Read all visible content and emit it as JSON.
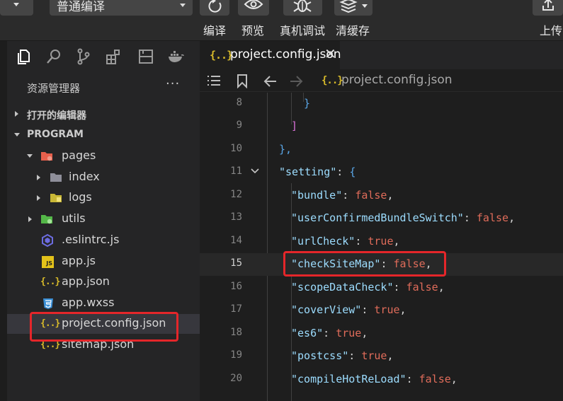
{
  "toolbar": {
    "mode_select": "普通编译",
    "compile_label": "编译",
    "preview_label": "预览",
    "device_debug_label": "真机调试",
    "clear_cache_label": "清缓存",
    "upload_label": "上传"
  },
  "sidebar": {
    "explorer_title": "资源管理器",
    "more_label": "···",
    "open_editors_label": "打开的编辑器",
    "project_label": "PROGRAM",
    "tree": [
      {
        "name": "pages",
        "kind": "folder",
        "expanded": true
      },
      {
        "name": "index",
        "kind": "folder",
        "expanded": false
      },
      {
        "name": "logs",
        "kind": "folder",
        "expanded": false
      },
      {
        "name": "utils",
        "kind": "folder",
        "expanded": false
      },
      {
        "name": ".eslintrc.js",
        "kind": "eslint"
      },
      {
        "name": "app.js",
        "kind": "js"
      },
      {
        "name": "app.json",
        "kind": "json"
      },
      {
        "name": "app.wxss",
        "kind": "css"
      },
      {
        "name": "project.config.json",
        "kind": "json",
        "selected": true
      },
      {
        "name": "sitemap.json",
        "kind": "json"
      }
    ]
  },
  "editor": {
    "tab_title": "project.config.json",
    "breadcrumb_file": "project.config.json",
    "json_icon": "{..}",
    "js_icon_text": "JS",
    "current_line": 15,
    "lines": [
      {
        "num": "8",
        "text": "}"
      },
      {
        "num": "9",
        "text": "]"
      },
      {
        "num": "10",
        "text": "},"
      },
      {
        "num": "11",
        "key": "\"setting\"",
        "sep": ": ",
        "value": "{"
      },
      {
        "num": "12",
        "key": "\"bundle\"",
        "sep": ": ",
        "value": "false",
        "end": ","
      },
      {
        "num": "13",
        "key": "\"userConfirmedBundleSwitch\"",
        "sep": ": ",
        "value": "false",
        "end": ","
      },
      {
        "num": "14",
        "key": "\"urlCheck\"",
        "sep": ": ",
        "value": "true",
        "end": ","
      },
      {
        "num": "15",
        "key": "\"checkSiteMap\"",
        "sep": ": ",
        "value": "false",
        "end": ","
      },
      {
        "num": "16",
        "key": "\"scopeDataCheck\"",
        "sep": ": ",
        "value": "false",
        "end": ","
      },
      {
        "num": "17",
        "key": "\"coverView\"",
        "sep": ": ",
        "value": "true",
        "end": ","
      },
      {
        "num": "18",
        "key": "\"es6\"",
        "sep": ": ",
        "value": "true",
        "end": ","
      },
      {
        "num": "19",
        "key": "\"postcss\"",
        "sep": ": ",
        "value": "true",
        "end": ","
      },
      {
        "num": "20",
        "key": "\"compileHotReLoad\"",
        "sep": ": ",
        "value": "false",
        "end": ","
      }
    ]
  },
  "colors": {
    "highlight_box": "#e5262a",
    "json_key": "#9cdcfe",
    "boolean": "#e06c5a"
  }
}
